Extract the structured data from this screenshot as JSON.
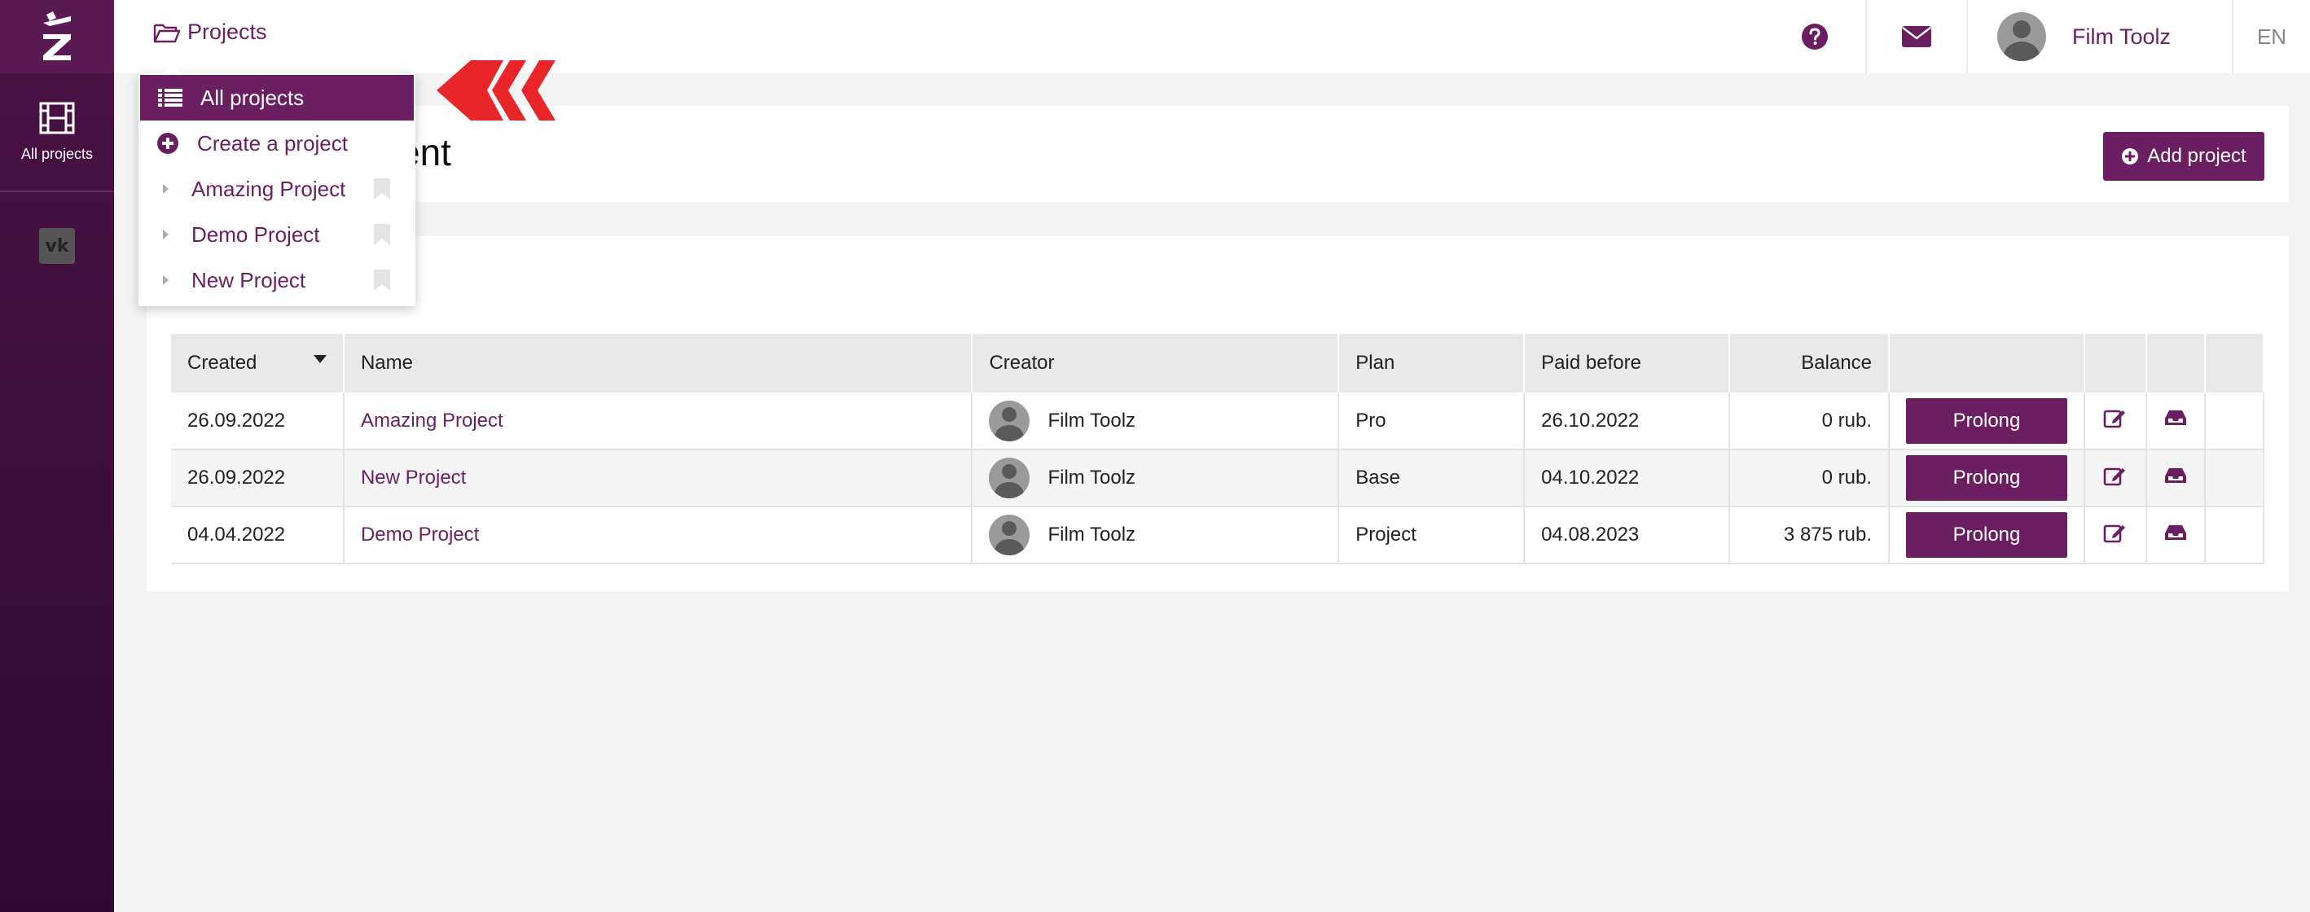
{
  "sidebar": {
    "logo": "logo-icon",
    "items": [
      {
        "label": "All projects",
        "icon": "film-icon"
      }
    ],
    "social": {
      "icon": "vk-icon",
      "glyph": "vk"
    }
  },
  "topbar": {
    "breadcrumb": "Projects",
    "user_name": "Film Toolz",
    "language": "EN",
    "help_icon": "help-icon",
    "mail_icon": "mail-icon"
  },
  "header": {
    "title_visible": "ent",
    "add_button": "Add project"
  },
  "dropdown": {
    "items": [
      {
        "label": "All projects",
        "icon": "list-icon",
        "active": true
      },
      {
        "label": "Create a project",
        "icon": "plus-circle-icon"
      },
      {
        "label": "Amazing Project",
        "icon": "caret-right-icon"
      },
      {
        "label": "Demo Project",
        "icon": "caret-right-icon"
      },
      {
        "label": "New Project",
        "icon": "caret-right-icon"
      }
    ]
  },
  "table": {
    "columns": [
      "Created",
      "Name",
      "Creator",
      "Plan",
      "Paid before",
      "Balance"
    ],
    "rows": [
      {
        "created": "26.09.2022",
        "name": "Amazing Project",
        "creator": "Film Toolz",
        "plan": "Pro",
        "paid_before": "26.10.2022",
        "balance": "0 rub.",
        "action": "Prolong"
      },
      {
        "created": "26.09.2022",
        "name": "New Project",
        "creator": "Film Toolz",
        "plan": "Base",
        "paid_before": "04.10.2022",
        "balance": "0 rub.",
        "action": "Prolong"
      },
      {
        "created": "04.04.2022",
        "name": "Demo Project",
        "creator": "Film Toolz",
        "plan": "Project",
        "paid_before": "04.08.2023",
        "balance": "3 875 rub.",
        "action": "Prolong"
      }
    ]
  },
  "colors": {
    "brand": "#6b1f62",
    "sidebar": "#3b0e39",
    "annotation_red": "#e8262a"
  }
}
